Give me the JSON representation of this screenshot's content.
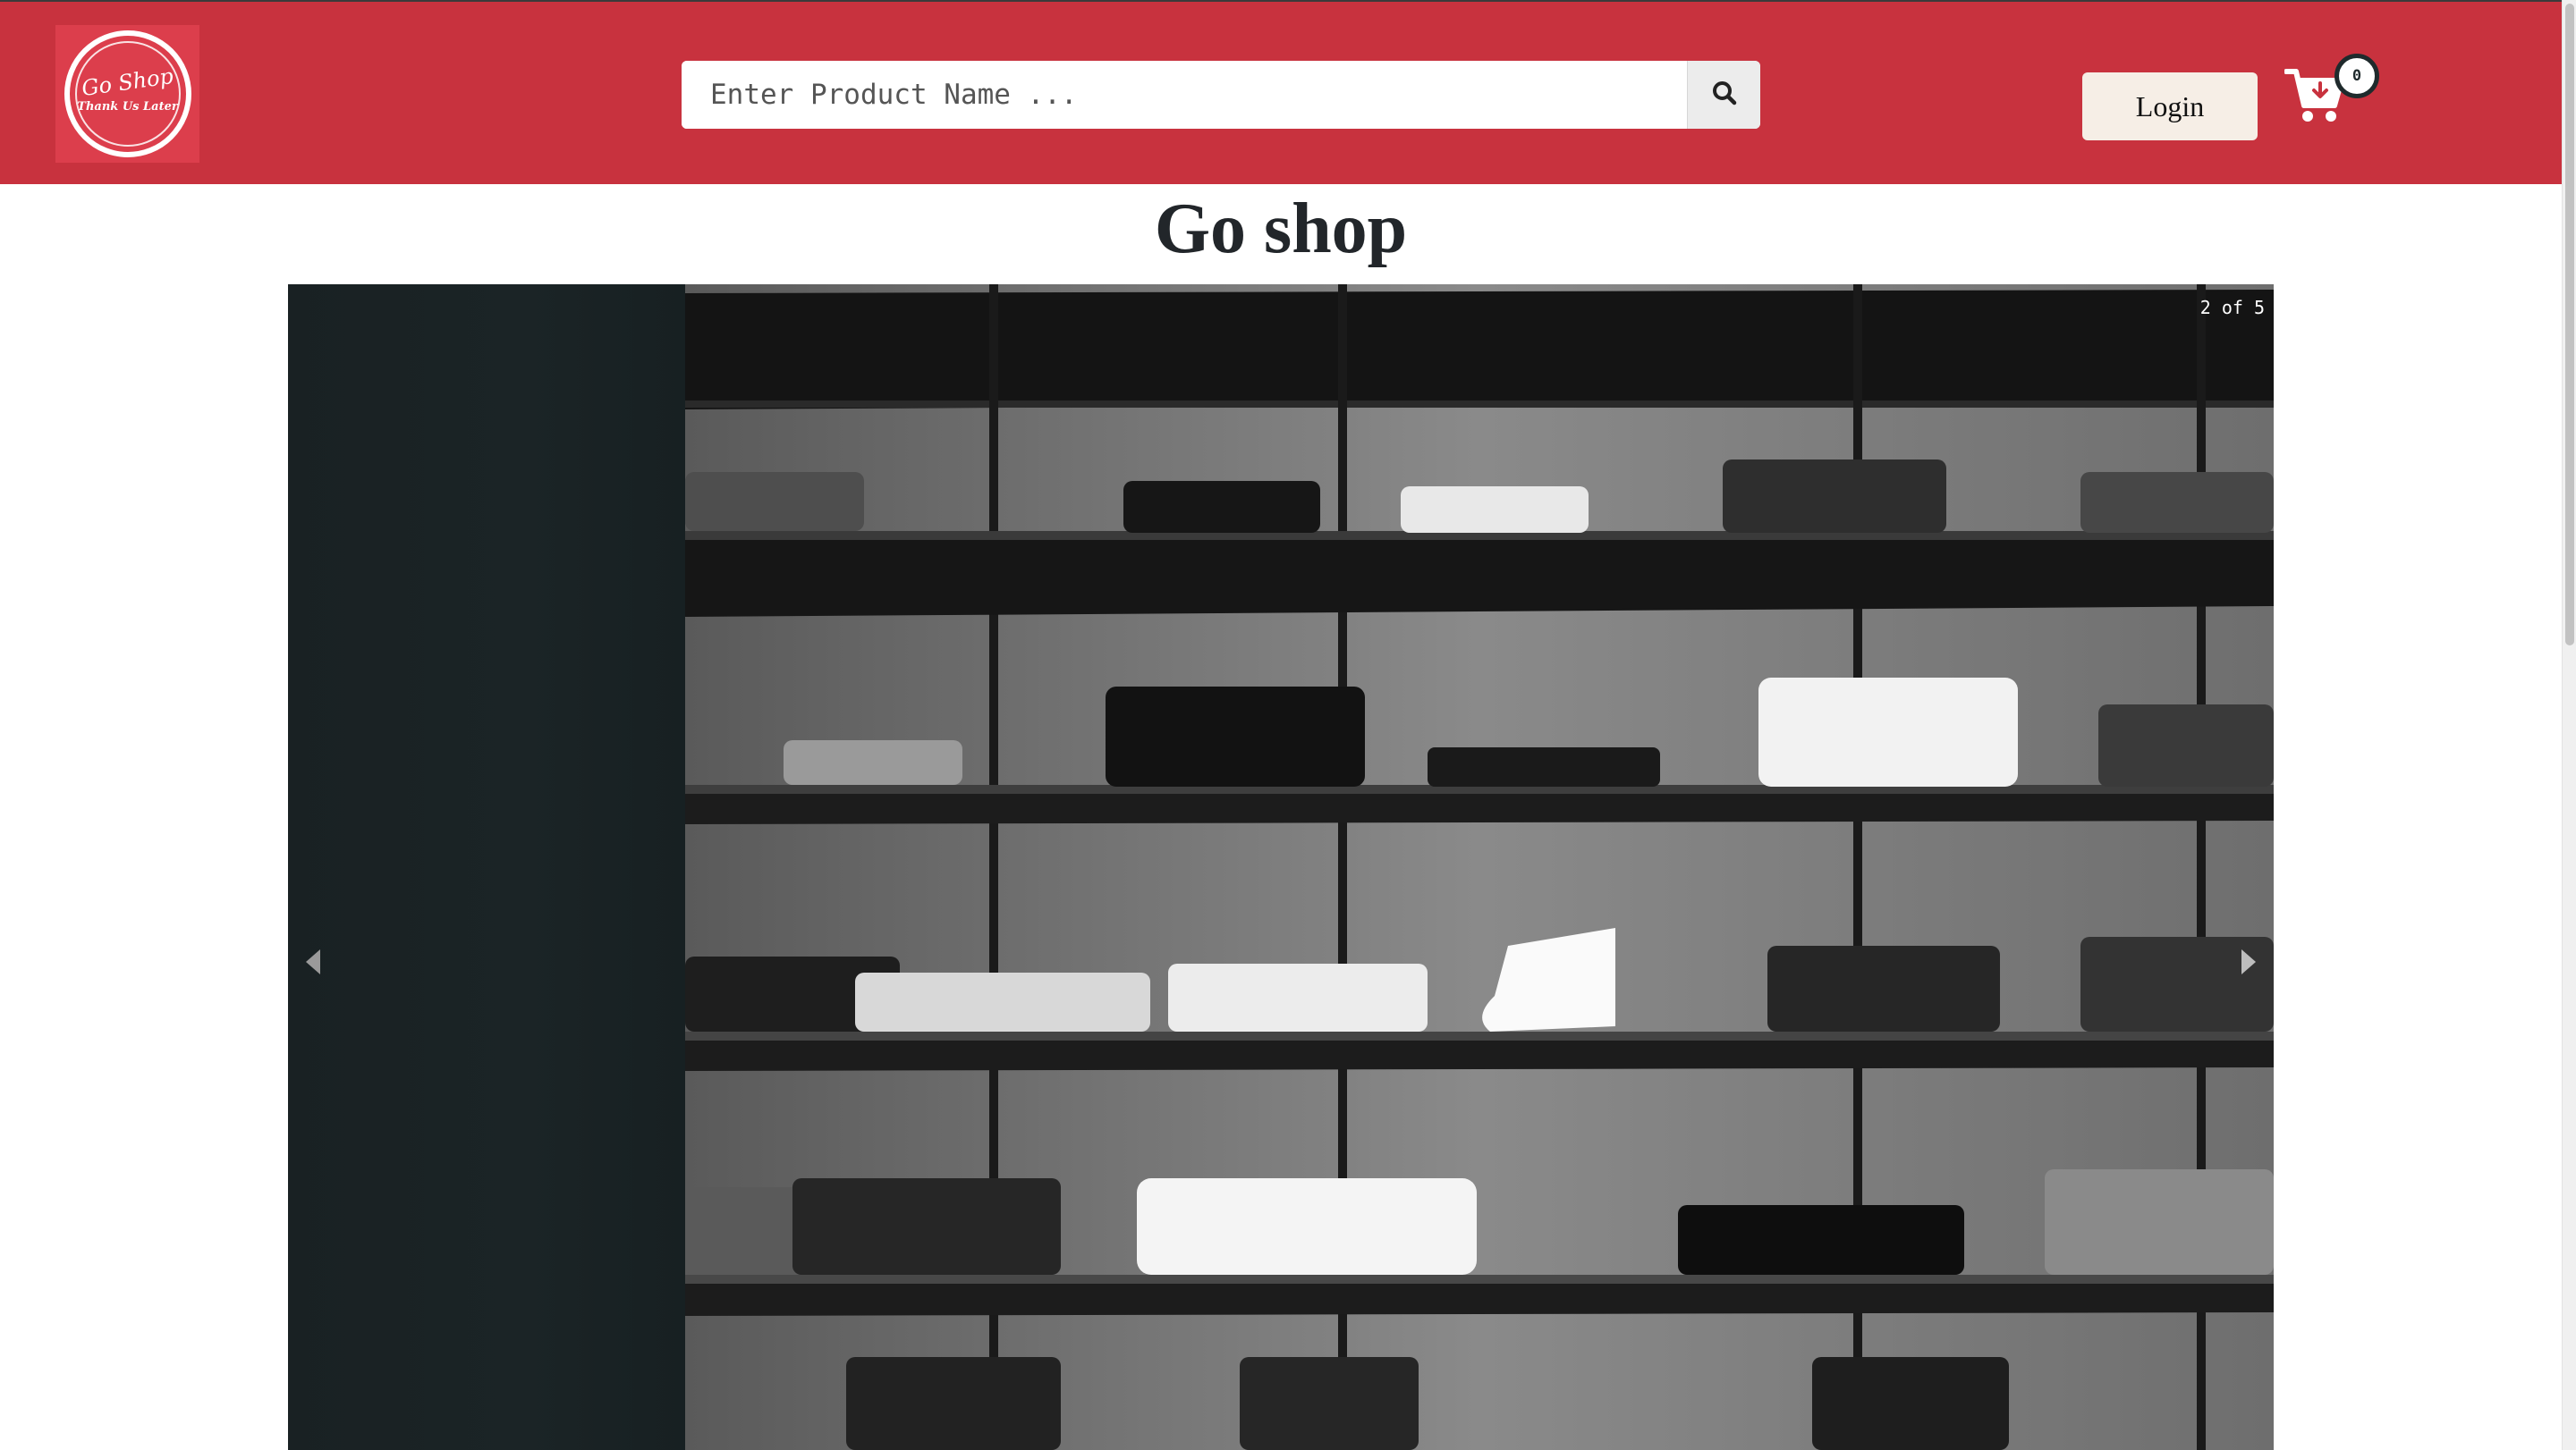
{
  "header": {
    "logo": {
      "title": "Go Shop",
      "tagline": "Thank Us Later",
      "color": "#dc3e4c"
    },
    "search": {
      "placeholder": "Enter Product Name ...",
      "value": "",
      "button_icon": "search-icon"
    },
    "login_label": "Login",
    "cart": {
      "icon": "cart-icon",
      "count": "0"
    },
    "background_color": "#c8323e"
  },
  "main": {
    "title": "Go shop",
    "carousel": {
      "counter": "2 of 5",
      "current": 2,
      "total": 5,
      "prev_icon": "caret-left-icon",
      "next_icon": "caret-right-icon",
      "image_subject": "monochrome clothing shelves"
    }
  },
  "colors": {
    "accent": "#c8323e",
    "login_bg": "#f6eee6",
    "title_text": "#22262a"
  }
}
